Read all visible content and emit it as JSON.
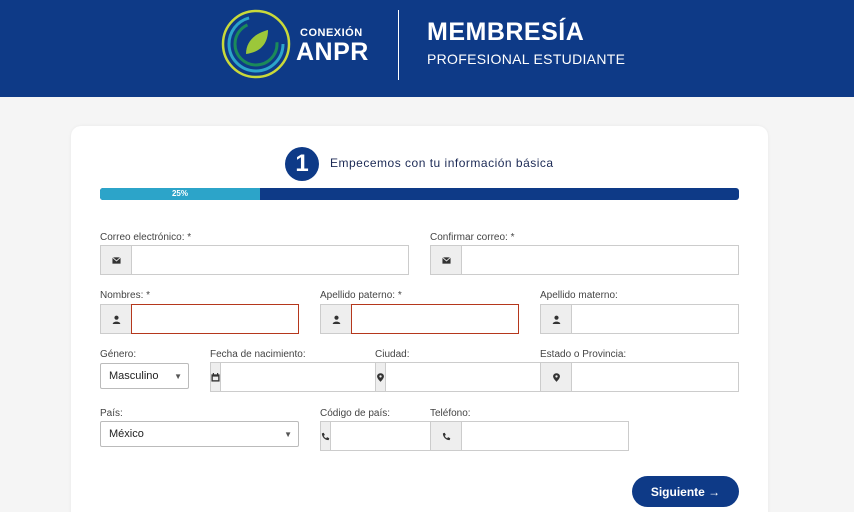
{
  "header": {
    "brand_small": "CONEXIÓN",
    "brand_big": "ANPR",
    "title": "MEMBRESÍA",
    "subtitle": "PROFESIONAL ESTUDIANTE"
  },
  "step": {
    "number": "1",
    "title": "Empecemos con tu información básica"
  },
  "progress": {
    "percent": 25,
    "label": "25%"
  },
  "form": {
    "email_label": "Correo electrónico: *",
    "confirm_email_label": "Confirmar correo: *",
    "first_name_label": "Nombres: *",
    "paternal_label": "Apellido paterno: *",
    "maternal_label": "Apellido materno:",
    "gender_label": "Género:",
    "gender_value": "Masculino",
    "birthdate_label": "Fecha de nacimiento:",
    "city_label": "Ciudad:",
    "state_label": "Estado o Provincia:",
    "country_label": "País:",
    "country_value": "México",
    "country_code_label": "Código de país:",
    "phone_label": "Teléfono:"
  },
  "buttons": {
    "next": "Siguiente →"
  },
  "colors": {
    "primary": "#0e3a87",
    "accent": "#2ca4c9",
    "error": "#b5371c"
  }
}
